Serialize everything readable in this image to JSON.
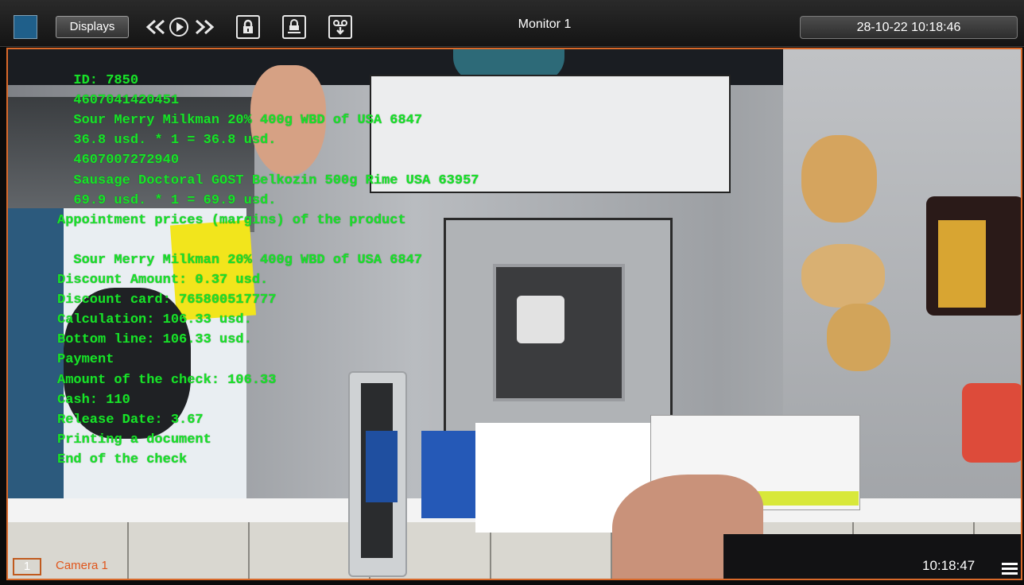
{
  "toolbar": {
    "displays_label": "Displays",
    "title": "Monitor 1",
    "datetime": "28-10-22 10:18:46",
    "icons": [
      "layout-square-icon",
      "rewind-icon",
      "play-icon",
      "fast-forward-icon",
      "lock-icon",
      "print-lock-icon",
      "tape-download-icon"
    ]
  },
  "receipt_lines": [
    "  ID: 7850",
    "  4607041420451",
    "  Sour Merry Milkman 20% 400g WBD of USA 6847",
    "  36.8 usd. * 1 = 36.8 usd.",
    "  4607007272940",
    "  Sausage Doctoral GOST Belkozin 500g Rime USA 63957",
    "  69.9 usd. * 1 = 69.9 usd.",
    "Appointment prices (margins) of the product",
    "",
    "  Sour Merry Milkman 20% 400g WBD of USA 6847",
    "Discount Amount: 0.37 usd.",
    "Discount card: 765800517777",
    "Calculation: 106.33 usd.",
    "Bottom line: 106.33 usd.",
    "Payment",
    "Amount of the check: 106.33",
    "Cash: 110",
    "Release Date: 3.67",
    "Printing a document",
    "End of the check"
  ],
  "camera": {
    "number": "1",
    "name": "Camera 1",
    "time": "10:18:47"
  },
  "colors": {
    "overlay_text": "#19e22a",
    "view_border": "#d9692a",
    "camera_name": "#e0561c"
  }
}
